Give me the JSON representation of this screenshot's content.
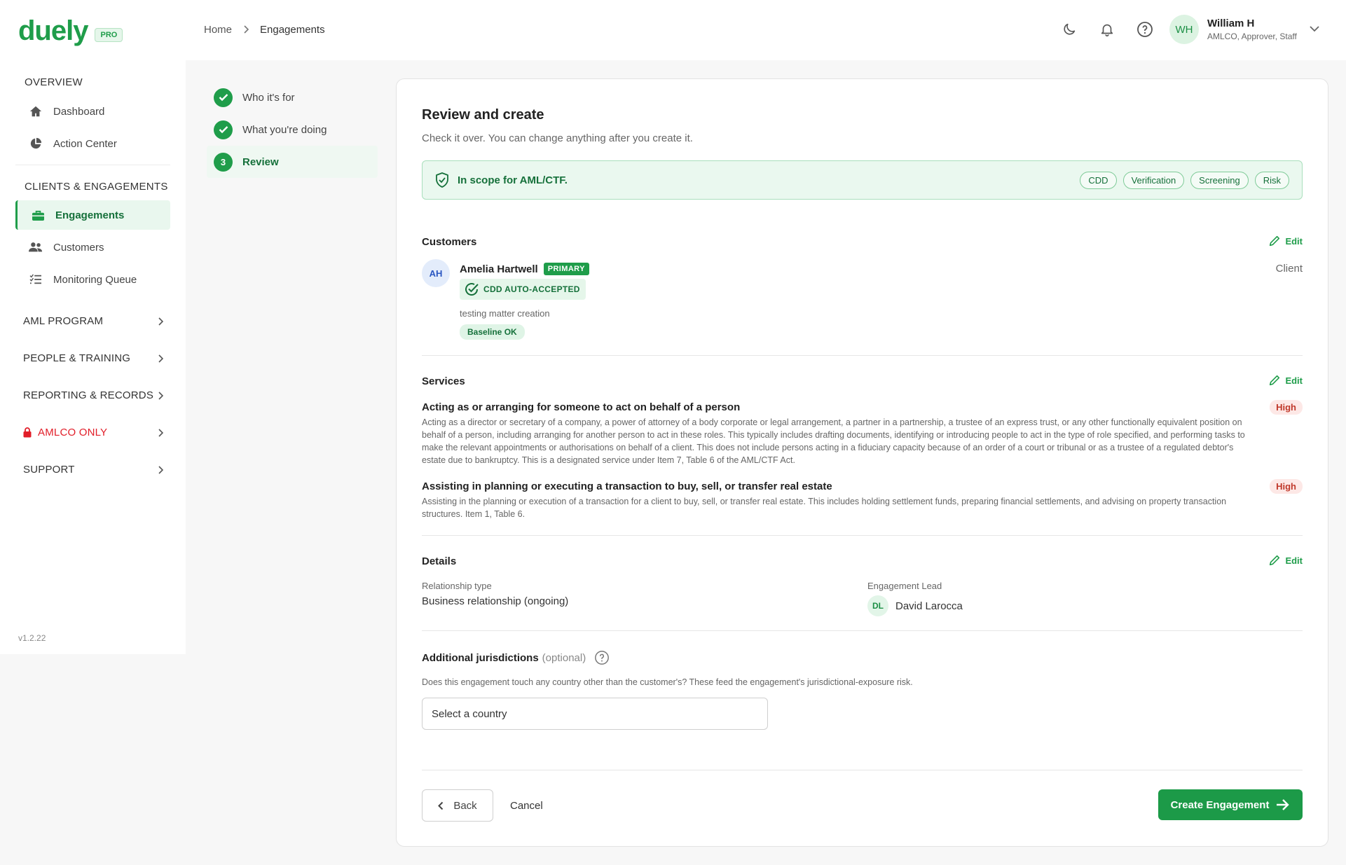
{
  "brand": {
    "name": "duely",
    "badge": "PRO"
  },
  "breadcrumb": {
    "home": "Home",
    "current": "Engagements"
  },
  "user": {
    "initials": "WH",
    "name": "William H",
    "roles": "AMLCO, Approver, Staff"
  },
  "top_icons": [
    "moon-icon",
    "bell-icon",
    "help-icon"
  ],
  "sidebar": {
    "overview_heading": "OVERVIEW",
    "dashboard": "Dashboard",
    "action_center": "Action Center",
    "clients_heading": "CLIENTS & ENGAGEMENTS",
    "engagements": "Engagements",
    "customers": "Customers",
    "monitoring_queue": "Monitoring Queue",
    "groups": {
      "aml_program": "AML PROGRAM",
      "people_training": "PEOPLE & TRAINING",
      "reporting_records": "REPORTING & RECORDS",
      "amlco_only": "AMLCO ONLY",
      "support": "SUPPORT"
    },
    "version": "v1.2.22"
  },
  "steps": {
    "who": "Who it's for",
    "what": "What you're doing",
    "review_number": "3",
    "review": "Review"
  },
  "review": {
    "title": "Review and create",
    "subtitle": "Check it over. You can change anything after you create it.",
    "scope": {
      "text": "In scope for AML/CTF.",
      "chip_cdd": "CDD",
      "chip_verification": "Verification",
      "chip_screening": "Screening",
      "chip_risk": "Risk"
    },
    "edit_label": "Edit",
    "customers": {
      "heading": "Customers",
      "initials": "AH",
      "name": "Amelia Hartwell",
      "primary_badge": "PRIMARY",
      "cdd_badge": "CDD AUTO-ACCEPTED",
      "note": "testing matter creation",
      "baseline": "Baseline OK",
      "role": "Client"
    },
    "services": {
      "heading": "Services",
      "s1_title": "Acting as or arranging for someone to act on behalf of a person",
      "s1_desc": "Acting as a director or secretary of a company, a power of attorney of a body corporate or legal arrangement, a partner in a partnership, a trustee of an express trust, or any other functionally equivalent position on behalf of a person, including arranging for another person to act in these roles. This typically includes drafting documents, identifying or introducing people to act in the type of role specified, and performing tasks to make the relevant appointments or authorisations on behalf of a client. This does not include persons acting in a fiduciary capacity because of an order of a court or tribunal or as a trustee of a regulated debtor's estate due to bankruptcy. This is a designated service under Item 7, Table 6 of the AML/CTF Act.",
      "s1_risk": "High",
      "s2_title": "Assisting in planning or executing a transaction to buy, sell, or transfer real estate",
      "s2_desc": "Assisting in the planning or execution of a transaction for a client to buy, sell, or transfer real estate. This includes holding settlement funds, preparing financial settlements, and advising on property transaction structures. Item 1, Table 6.",
      "s2_risk": "High"
    },
    "details": {
      "heading": "Details",
      "relationship_label": "Relationship type",
      "relationship_value": "Business relationship (ongoing)",
      "lead_label": "Engagement Lead",
      "lead_initials": "DL",
      "lead_name": "David Larocca"
    },
    "jurisdictions": {
      "heading": "Additional jurisdictions",
      "optional": "(optional)",
      "description": "Does this engagement touch any country other than the customer's? These feed the engagement's jurisdictional-exposure risk.",
      "placeholder": "Select a country"
    },
    "actions": {
      "back": "Back",
      "cancel": "Cancel",
      "create": "Create Engagement"
    }
  },
  "colors": {
    "accent": "#1f9d4a",
    "danger": "#e11d28",
    "risk_high": "#c0392b"
  }
}
